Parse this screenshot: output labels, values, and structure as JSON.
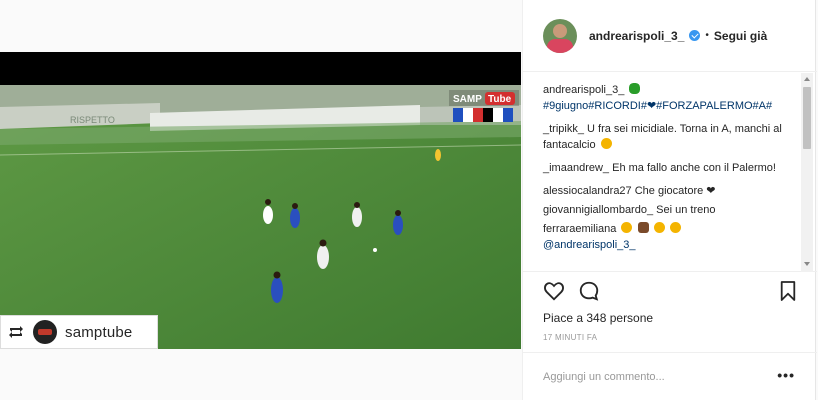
{
  "video": {
    "logo_text": "SAMP",
    "logo_text_2": "Tube",
    "banner_text": "RISPETTO",
    "repost_account": "samptube"
  },
  "header": {
    "username": "andrearispoli_3_",
    "separator": "•",
    "follow_label": "Segui già"
  },
  "caption": {
    "username": "andrearispoli_3_",
    "tags": "#9giugno#RICORDI#❤#FORZAPALERMO#A#"
  },
  "comments": [
    {
      "username": "_tripikk_",
      "text": "U fra sei micidiale. Torna in A, manchi al fantacalcio"
    },
    {
      "username": "_imaandrew_",
      "text": "Eh ma fallo anche con il Palermo!"
    },
    {
      "username": "alessiocalandra27",
      "text": "Che giocatore"
    },
    {
      "username": "giovannigiallombardo_",
      "text": "Sei un treno"
    },
    {
      "username": "ferraraemiliana",
      "text": ""
    },
    {
      "username": "@andrearispoli_3_",
      "text": ""
    }
  ],
  "likes_text": "Piace a 348 persone",
  "time_text": "17 MINUTI FA",
  "add_comment": {
    "placeholder": "Aggiungi un commento..."
  },
  "more_label": "•••",
  "colors": {
    "link": "#003569",
    "verified": "#3897f0",
    "pitch": "#4e8a3a"
  },
  "icons": [
    "heart-icon",
    "comment-icon",
    "bookmark-icon",
    "repost-icon",
    "verified-icon",
    "more-icon"
  ]
}
